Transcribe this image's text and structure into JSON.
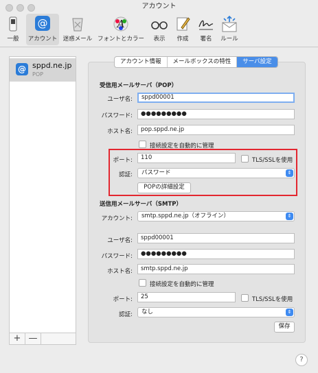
{
  "window": {
    "title": "アカウント"
  },
  "toolbar": {
    "items": [
      {
        "label": "一般",
        "icon": "switch-icon"
      },
      {
        "label": "アカウント",
        "icon": "at-sign-icon",
        "selected": true
      },
      {
        "label": "迷惑メール",
        "icon": "trash-icon"
      },
      {
        "label": "フォントとカラー",
        "icon": "font-color-icon"
      },
      {
        "label": "表示",
        "icon": "glasses-icon"
      },
      {
        "label": "作成",
        "icon": "compose-icon"
      },
      {
        "label": "署名",
        "icon": "signature-icon"
      },
      {
        "label": "ルール",
        "icon": "rules-icon"
      }
    ]
  },
  "sidebar": {
    "account": {
      "name": "sppd.ne.jp",
      "type": "POP"
    },
    "add_label": "+",
    "remove_label": "—"
  },
  "tabs": [
    {
      "label": "アカウント情報"
    },
    {
      "label": "メールボックスの特性"
    },
    {
      "label": "サーバ設定",
      "active": true
    }
  ],
  "pop": {
    "section_title": "受信用メールサーバ（POP）",
    "username_label": "ユーザ名:",
    "username": "sppd00001",
    "password_label": "パスワード:",
    "password": "●●●●●●●●●",
    "host_label": "ホスト名:",
    "host": "pop.sppd.ne.jp",
    "auto_manage_label": "接続設定を自動的に管理",
    "port_label": "ポート:",
    "port": "110",
    "tls_label": "TLS/SSLを使用",
    "auth_label": "認証:",
    "auth": "パスワード",
    "advanced_button": "POPの詳細設定"
  },
  "smtp": {
    "section_title": "送信用メールサーバ（SMTP）",
    "account_label": "アカウント:",
    "account": "smtp.sppd.ne.jp（オフライン）",
    "username_label": "ユーザ名:",
    "username": "sppd00001",
    "password_label": "パスワード:",
    "password": "●●●●●●●●●",
    "host_label": "ホスト名:",
    "host": "smtp.sppd.ne.jp",
    "auto_manage_label": "接続設定を自動的に管理",
    "port_label": "ポート:",
    "port": "25",
    "tls_label": "TLS/SSLを使用",
    "auth_label": "認証:",
    "auth": "なし",
    "save_button": "保存"
  },
  "help": {
    "label": "?"
  },
  "colors": {
    "accent": "#4a8ee8",
    "highlight": "#e3262f"
  }
}
